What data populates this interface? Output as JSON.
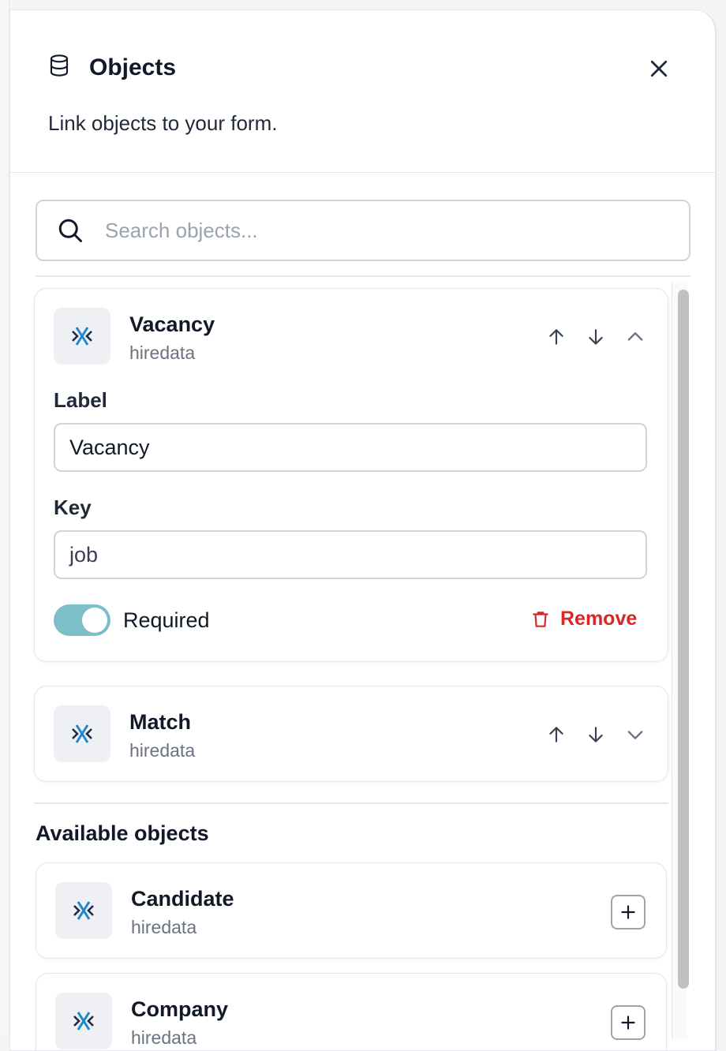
{
  "header": {
    "title": "Objects",
    "subtitle": "Link objects to your form.",
    "icon": "database-icon",
    "close_icon": "close-icon"
  },
  "search": {
    "placeholder": "Search objects..."
  },
  "linked_objects": [
    {
      "name": "Vacancy",
      "source": "hiredata",
      "expanded": true,
      "label_title": "Label",
      "label_value": "Vacancy",
      "key_title": "Key",
      "key_value": "job",
      "required_label": "Required",
      "required": true,
      "remove_label": "Remove"
    },
    {
      "name": "Match",
      "source": "hiredata",
      "expanded": false
    }
  ],
  "available": {
    "title": "Available objects",
    "items": [
      {
        "name": "Candidate",
        "source": "hiredata"
      },
      {
        "name": "Company",
        "source": "hiredata"
      }
    ]
  },
  "colors": {
    "toggle_on": "#7cbfc6",
    "danger": "#dc2626",
    "logo_blue": "#1e88c8",
    "logo_dark": "#1b2a4a"
  }
}
